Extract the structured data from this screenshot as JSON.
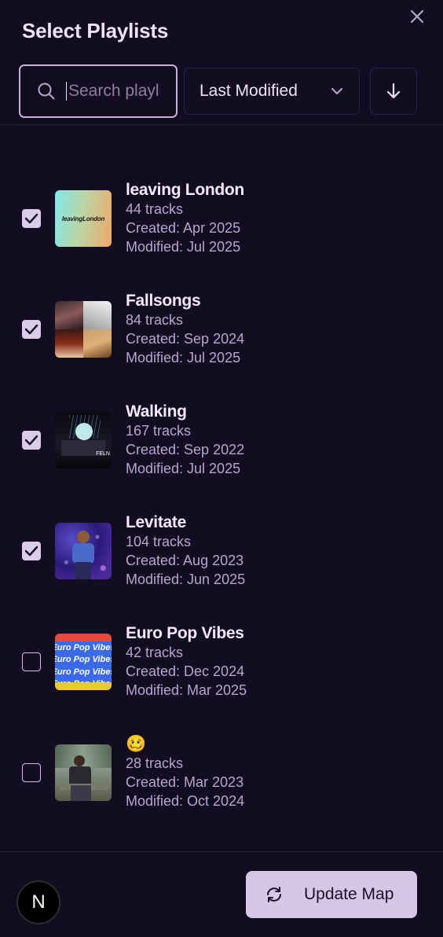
{
  "dialog": {
    "title": "Select Playlists"
  },
  "toolbar": {
    "search_placeholder": "Search playlists",
    "sort_label": "Last Modified",
    "sort_direction": "descending"
  },
  "playlists": [
    {
      "name": "leaving London",
      "tracks": "44 tracks",
      "created": "Created: Apr 2025",
      "modified": "Modified: Jul 2025",
      "checked": true,
      "cover_text": "leavingLondon"
    },
    {
      "name": "Fallsongs",
      "tracks": "84 tracks",
      "created": "Created: Sep 2024",
      "modified": "Modified: Jul 2025",
      "checked": true
    },
    {
      "name": "Walking",
      "tracks": "167 tracks",
      "created": "Created: Sep 2022",
      "modified": "Modified: Jul 2025",
      "checked": true,
      "cover_text": "FELN"
    },
    {
      "name": "Levitate",
      "tracks": "104 tracks",
      "created": "Created: Aug 2023",
      "modified": "Modified: Jun 2025",
      "checked": true
    },
    {
      "name": "Euro Pop Vibes",
      "tracks": "42 tracks",
      "created": "Created: Dec 2024",
      "modified": "Modified: Mar 2025",
      "checked": false,
      "cover_text": "Euro Pop Vibes"
    },
    {
      "name": "🥴",
      "tracks": "28 tracks",
      "created": "Created: Mar 2023",
      "modified": "Modified: Oct 2024",
      "checked": false
    }
  ],
  "footer": {
    "avatar_letter": "N",
    "update_label": "Update Map"
  },
  "colors": {
    "background": "#130d22",
    "accent": "#d6c6e8",
    "muted_text": "#b7a6ce"
  }
}
